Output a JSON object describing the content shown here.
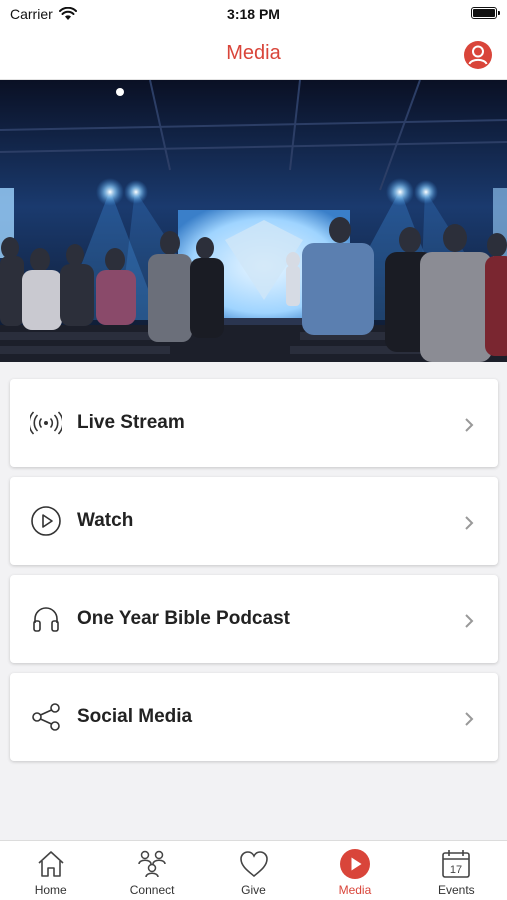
{
  "status_bar": {
    "carrier": "Carrier",
    "time": "3:18 PM"
  },
  "nav": {
    "title": "Media"
  },
  "menu": [
    {
      "label": "Live Stream",
      "icon": "broadcast-icon"
    },
    {
      "label": "Watch",
      "icon": "play-circle-icon"
    },
    {
      "label": "One Year Bible Podcast",
      "icon": "headphones-icon"
    },
    {
      "label": "Social Media",
      "icon": "share-icon"
    }
  ],
  "tabs": [
    {
      "label": "Home",
      "icon": "home-icon",
      "active": false
    },
    {
      "label": "Connect",
      "icon": "people-icon",
      "active": false
    },
    {
      "label": "Give",
      "icon": "heart-icon",
      "active": false
    },
    {
      "label": "Media",
      "icon": "play-circle-filled-icon",
      "active": true
    },
    {
      "label": "Events",
      "icon": "calendar-icon",
      "active": false,
      "calendar_day": "17"
    }
  ],
  "colors": {
    "accent": "#d9453a",
    "background": "#f2f2f4",
    "card": "#ffffff"
  }
}
